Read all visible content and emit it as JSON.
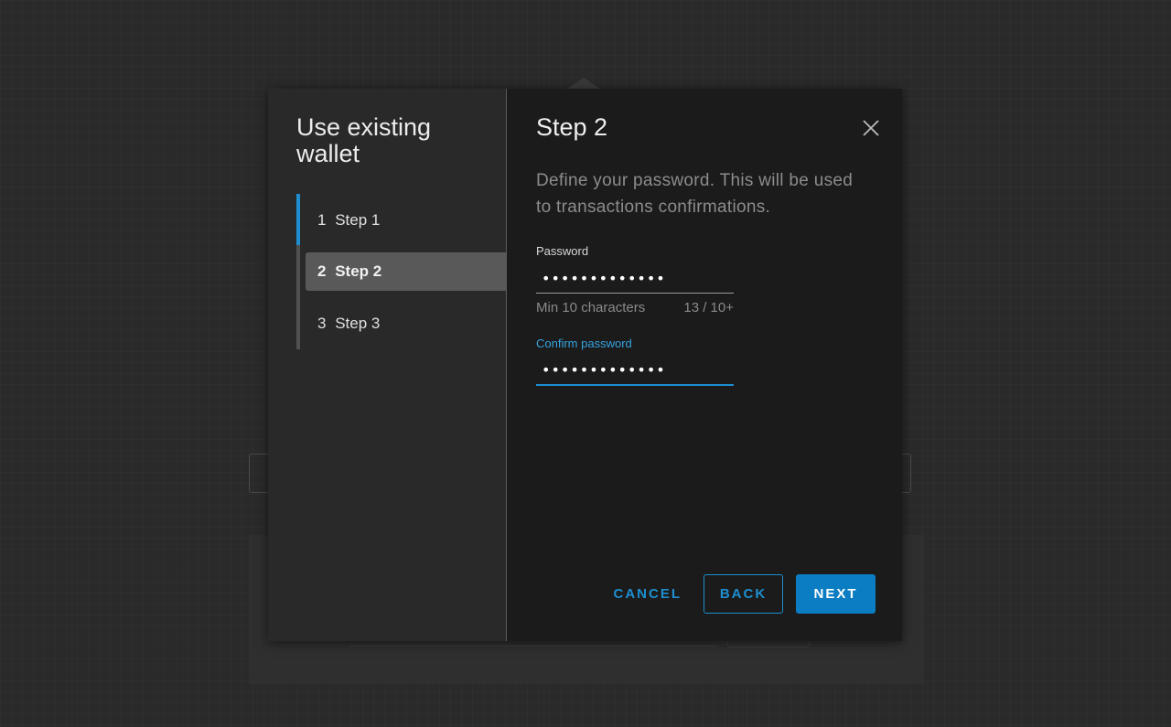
{
  "wizard": {
    "title": "Use existing wallet",
    "steps": [
      {
        "number": "1",
        "label": "Step 1"
      },
      {
        "number": "2",
        "label": "Step 2"
      },
      {
        "number": "3",
        "label": "Step 3"
      }
    ],
    "active_step": 2
  },
  "body": {
    "title": "Step 2",
    "description": "Define your password. This will be used to transactions confirmations.",
    "password": {
      "label": "Password",
      "value": "•••••••••••••",
      "helper": "Min 10 characters",
      "counter": "13 / 10+"
    },
    "confirm_password": {
      "label": "Confirm password",
      "value": "•••••••••••••"
    }
  },
  "footer": {
    "cancel_label": "CANCEL",
    "back_label": "BACK",
    "next_label": "NEXT"
  },
  "icons": {
    "close": "close-icon"
  },
  "colors": {
    "accent": "#1d8ed0",
    "primary_button": "#0b7dc2",
    "modal_nav_bg": "#292929",
    "modal_body_bg": "#1b1b1b",
    "backdrop": "#2a2a2a"
  }
}
